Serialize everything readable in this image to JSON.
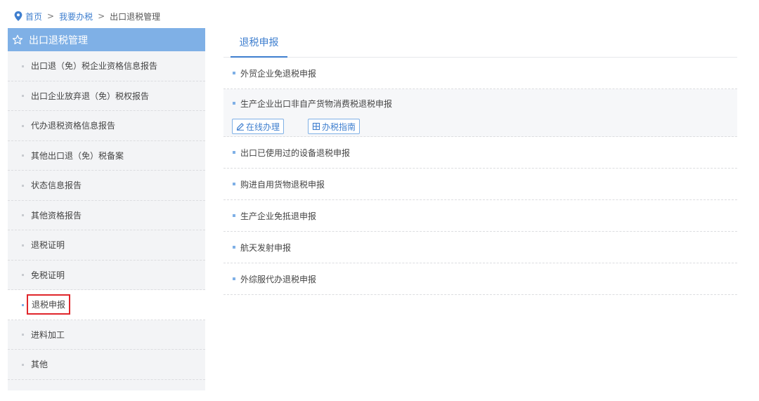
{
  "breadcrumb": {
    "items": [
      "首页",
      "我要办税"
    ],
    "separator": ">",
    "current": "出口退税管理"
  },
  "sidebar": {
    "title": "出口退税管理",
    "items": [
      {
        "label": "出口退（免）税企业资格信息报告"
      },
      {
        "label": "出口企业放弃退（免）税权报告"
      },
      {
        "label": "代办退税资格信息报告"
      },
      {
        "label": "其他出口退（免）税备案"
      },
      {
        "label": "状态信息报告"
      },
      {
        "label": "其他资格报告"
      },
      {
        "label": "退税证明"
      },
      {
        "label": "免税证明"
      },
      {
        "label": "退税申报",
        "active": true
      },
      {
        "label": "进料加工"
      },
      {
        "label": "其他"
      }
    ]
  },
  "main": {
    "tab": "退税申报",
    "items": [
      {
        "label": "外贸企业免退税申报"
      },
      {
        "label": "生产企业出口非自产货物消费税退税申报",
        "expanded": true
      },
      {
        "label": "出口已使用过的设备退税申报"
      },
      {
        "label": "购进自用货物退税申报"
      },
      {
        "label": "生产企业免抵退申报"
      },
      {
        "label": "航天发射申报"
      },
      {
        "label": "外综服代办退税申报"
      }
    ],
    "actions": {
      "online": "在线办理",
      "guide": "办税指南"
    }
  },
  "colors": {
    "accent": "#7fb0e6",
    "link": "#3f7fcf",
    "highlight_border": "#e0262b"
  },
  "icons": {
    "location": "location-pin-icon",
    "star": "star-icon",
    "edit": "pencil-icon",
    "guide": "book-icon"
  }
}
